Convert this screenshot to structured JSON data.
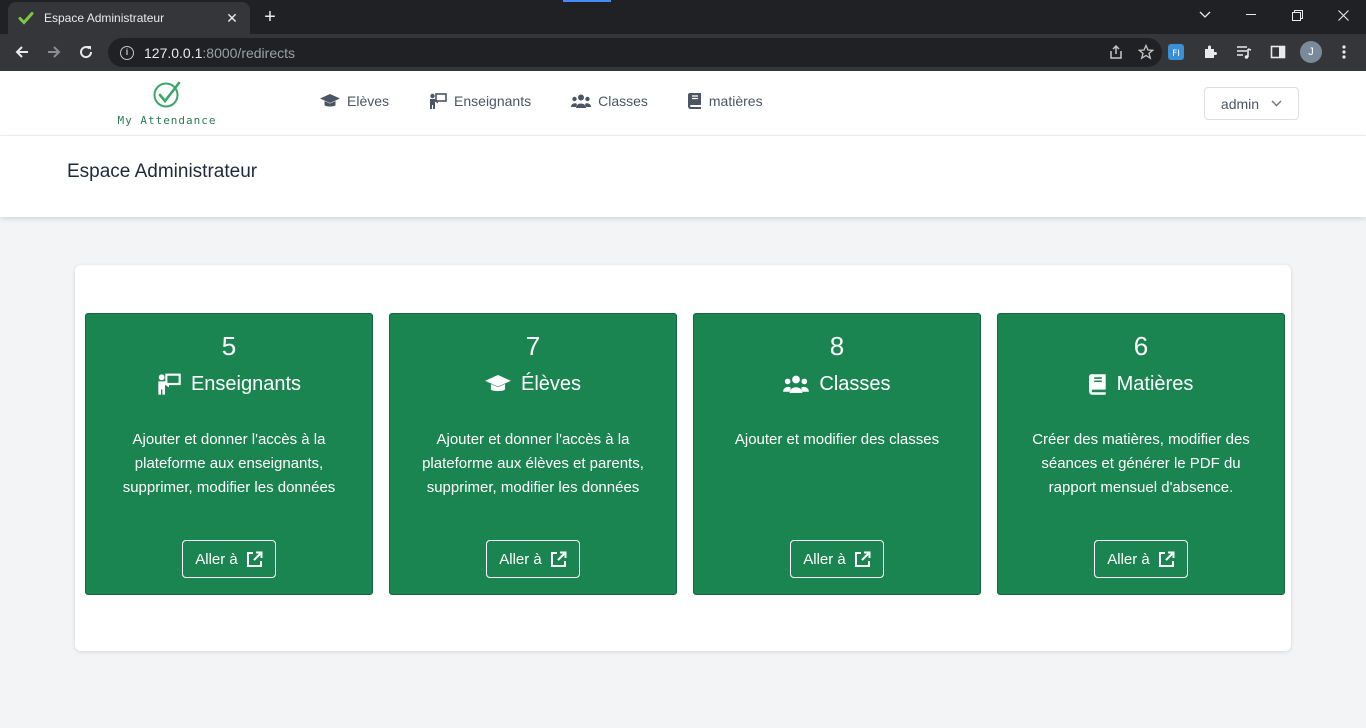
{
  "browser": {
    "tab_title": "Espace Administrateur",
    "url_host": "127.0.0.1",
    "url_rest": ":8000/redirects",
    "profile_initial": "J",
    "ext_label": "FI"
  },
  "app": {
    "logo_text": "My Attendance",
    "nav": [
      {
        "label": "Elèves",
        "icon": "graduation-cap-icon"
      },
      {
        "label": "Enseignants",
        "icon": "teacher-board-icon"
      },
      {
        "label": "Classes",
        "icon": "users-icon"
      },
      {
        "label": "matières",
        "icon": "book-icon"
      }
    ],
    "user_menu": "admin",
    "page_title": "Espace Administrateur"
  },
  "cards": [
    {
      "count": "5",
      "title": "Enseignants",
      "icon": "teacher-board-icon",
      "description": "Ajouter et donner l'accès à la plateforme aux enseignants, supprimer, modifier les données",
      "button": "Aller à"
    },
    {
      "count": "7",
      "title": "Élèves",
      "icon": "graduation-cap-icon",
      "description": "Ajouter et donner l'accès à la plateforme aux élèves et parents, supprimer, modifier les données",
      "button": "Aller à"
    },
    {
      "count": "8",
      "title": "Classes",
      "icon": "users-icon",
      "description": "Ajouter et modifier des classes",
      "button": "Aller à"
    },
    {
      "count": "6",
      "title": "Matières",
      "icon": "book-icon",
      "description": "Créer des matières, modifier des séances et générer le PDF du rapport mensuel d'absence.",
      "button": "Aller à"
    }
  ],
  "colors": {
    "card_green": "#1b8551",
    "logo_green": "#2f7a54",
    "chrome_dark": "#202124"
  }
}
